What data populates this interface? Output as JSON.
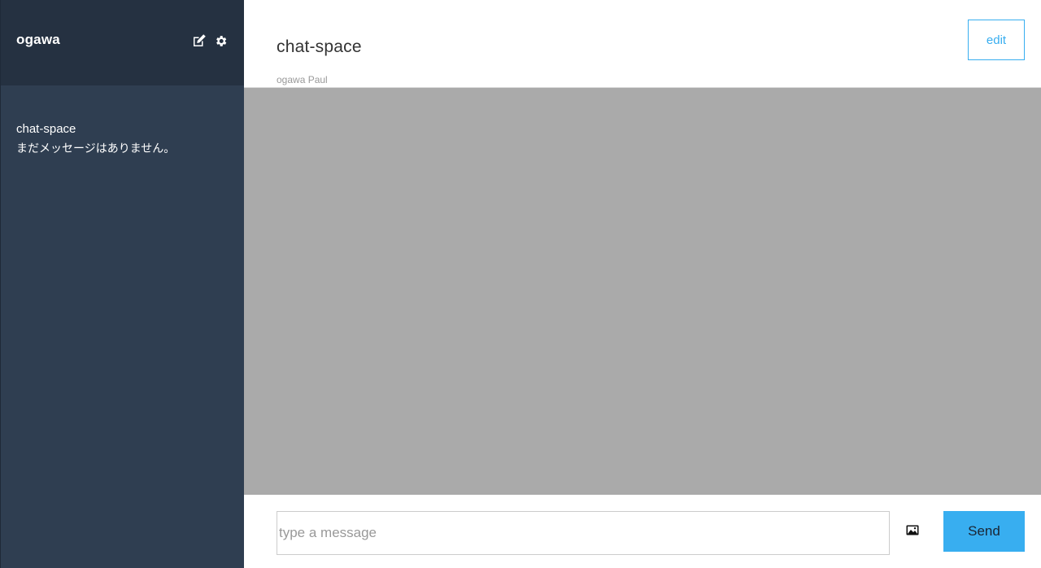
{
  "sidebar": {
    "user_name": "ogawa",
    "icons": [
      "edit-icon",
      "gear-icon"
    ],
    "groups": [
      {
        "name": "chat-space",
        "latest_message": "まだメッセージはありません。"
      }
    ]
  },
  "main": {
    "chat_title": "chat-space",
    "members": "ogawa Paul",
    "edit_label": "edit",
    "form": {
      "placeholder": "type a message",
      "value": "",
      "image_icon": "image-icon",
      "send_label": "Send"
    }
  },
  "colors": {
    "sidebar_bg": "#2f3e51",
    "sidebar_header_bg": "#253141",
    "accent": "#38aef0",
    "messages_bg": "#aaaaaa"
  }
}
